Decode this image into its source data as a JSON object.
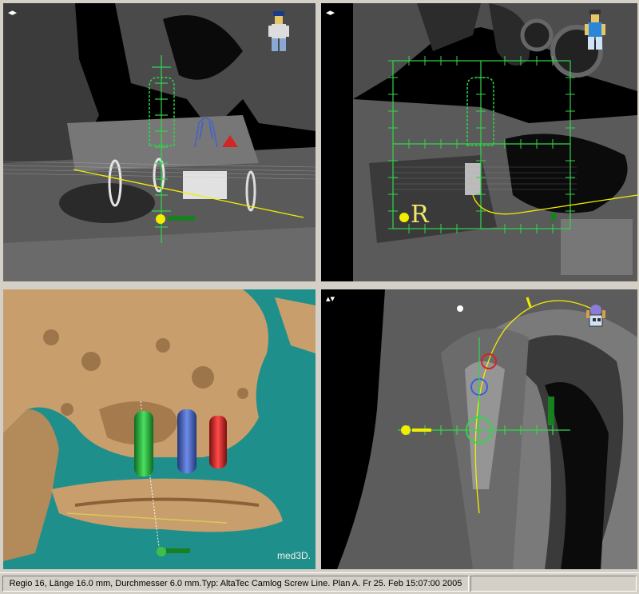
{
  "viewports": {
    "top_left": {
      "control_icon": "◂▸"
    },
    "top_right": {
      "control_icon": "◂▸"
    },
    "bottom_left": {
      "watermark": "med3D."
    },
    "bottom_right": {
      "control_icon": "▴▾"
    }
  },
  "orientation_label": "R",
  "status": {
    "text": "Regio 16, Länge 16.0 mm, Durchmesser 6.0 mm.Typ: AltaTec Camlog Screw Line. Plan A. Fr 25. Feb 15:07:00 2005"
  },
  "colors": {
    "guide_green": "#31d64a",
    "trajectory_yellow": "#f2ee00",
    "implant_blue": "#3b5fd8",
    "implant_red": "#d42424",
    "bone_tan": "#c99e6d",
    "background_teal": "#1f8f8c"
  }
}
